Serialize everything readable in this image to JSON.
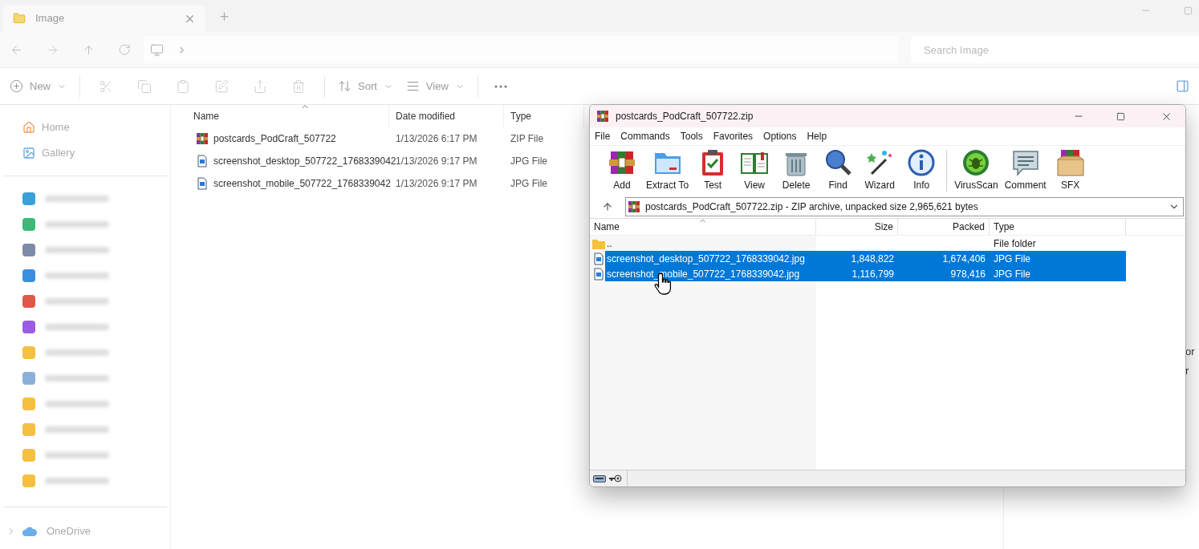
{
  "explorer": {
    "tab": {
      "title": "Image"
    },
    "search": {
      "placeholder": "Search Image"
    },
    "commands": [
      {
        "label": "New",
        "kind": "menu"
      },
      {
        "kind": "cut"
      },
      {
        "kind": "copy"
      },
      {
        "kind": "paste"
      },
      {
        "kind": "rename"
      },
      {
        "kind": "share"
      },
      {
        "kind": "delete"
      },
      {
        "label": "Sort",
        "kind": "menu"
      },
      {
        "label": "View",
        "kind": "menu"
      },
      {
        "kind": "more"
      }
    ],
    "sidebar": {
      "top": [
        {
          "label": "Home"
        },
        {
          "label": "Gallery"
        }
      ],
      "blurred_items": [
        {
          "color": "#3aa0d8"
        },
        {
          "color": "#3cb878"
        },
        {
          "color": "#7d8aa8"
        },
        {
          "color": "#3a8ee0"
        },
        {
          "color": "#e0584a"
        },
        {
          "color": "#9a5ce0"
        },
        {
          "color": "#f5c040"
        },
        {
          "color": "#8ab0d8"
        },
        {
          "color": "#f5c040"
        },
        {
          "color": "#f5c040"
        },
        {
          "color": "#f5c040"
        },
        {
          "color": "#f5c040"
        }
      ],
      "bottom": [
        {
          "label": "OneDrive",
          "expanded": false
        }
      ]
    },
    "columns": [
      "Name",
      "Date modified",
      "Type"
    ],
    "files": [
      {
        "name": "postcards_PodCraft_507722",
        "date": "1/13/2026 6:17 PM",
        "type": "ZIP File",
        "kind": "zip"
      },
      {
        "name": "screenshot_desktop_507722_1768339042",
        "date": "1/13/2026 9:17 PM",
        "type": "JPG File",
        "kind": "image"
      },
      {
        "name": "screenshot_mobile_507722_1768339042",
        "date": "1/13/2026 9:17 PM",
        "type": "JPG File",
        "kind": "image"
      }
    ],
    "details_fragments": [
      "or",
      "r"
    ]
  },
  "winrar": {
    "title": "postcards_PodCraft_507722.zip",
    "menu": [
      "File",
      "Commands",
      "Tools",
      "Favorites",
      "Options",
      "Help"
    ],
    "toolbar": [
      "Add",
      "Extract To",
      "Test",
      "View",
      "Delete",
      "Find",
      "Wizard",
      "Info",
      "VirusScan",
      "Comment",
      "SFX"
    ],
    "address": "postcards_PodCraft_507722.zip - ZIP archive, unpacked size 2,965,621 bytes",
    "columns": [
      "Name",
      "Size",
      "Packed",
      "Type"
    ],
    "rows": [
      {
        "name": "..",
        "size": "",
        "packed": "",
        "type": "File folder",
        "kind": "folder",
        "selected": false
      },
      {
        "name": "screenshot_desktop_507722_1768339042.jpg",
        "size": "1,848,822",
        "packed": "1,674,406",
        "type": "JPG File",
        "kind": "image",
        "selected": true
      },
      {
        "name": "screenshot_mobile_507722_1768339042.jpg",
        "size": "1,116,799",
        "packed": "978,416",
        "type": "JPG File",
        "kind": "image",
        "selected": true
      }
    ]
  }
}
